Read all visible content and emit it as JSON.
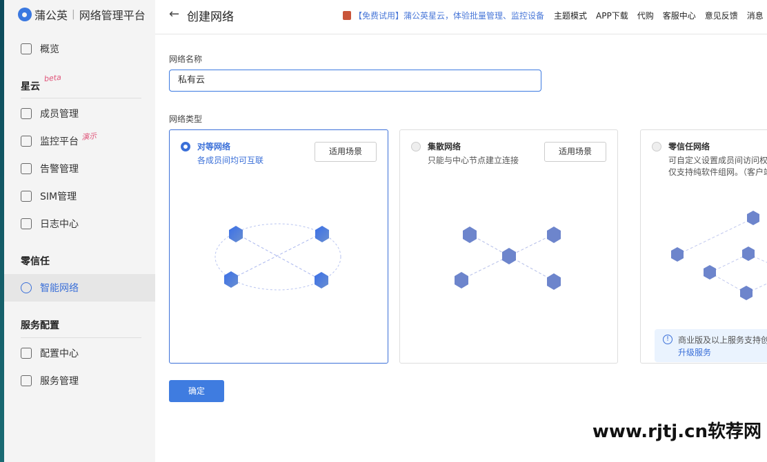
{
  "brand": {
    "name": "蒲公英",
    "product": "网络管理平台"
  },
  "sidebar": {
    "overview": "概览",
    "sections": [
      {
        "title": "星云",
        "tag": "beta",
        "items": [
          "成员管理",
          "监控平台",
          "告警管理",
          "SIM管理",
          "日志中心"
        ],
        "item_tags": {
          "1": "演示"
        }
      },
      {
        "title": "零信任",
        "items": [
          "智能网络"
        ]
      },
      {
        "title": "服务配置",
        "items": [
          "配置中心",
          "服务管理"
        ]
      }
    ]
  },
  "header": {
    "title": "创建网络",
    "back": "←",
    "promo": "【免费试用】蒲公英星云，体验批量管理、监控设备",
    "links": [
      "主题模式",
      "APP下载",
      "代购",
      "客服中心",
      "意见反馈",
      "消息"
    ]
  },
  "form": {
    "name_label": "网络名称",
    "name_value": "私有云",
    "type_label": "网络类型",
    "submit": "确定"
  },
  "cards": [
    {
      "name": "对等网络",
      "desc": "各成员间均可互联",
      "button": "适用场景",
      "selected": true
    },
    {
      "name": "集散网络",
      "desc": "只能与中心节点建立连接",
      "button": "适用场景",
      "selected": false
    },
    {
      "name": "零信任网络",
      "desc": "可自定义设置成员间访问权",
      "desc2": "仅支持纯软件组网。（客户端",
      "notice": "商业版及以上服务支持创",
      "notice_link": "升级服务",
      "selected": false
    }
  ],
  "watermark": "www.rjtj.cn软荐网",
  "colors": {
    "accent": "#3a6fd8",
    "sidebar": "#f4f4f4"
  }
}
